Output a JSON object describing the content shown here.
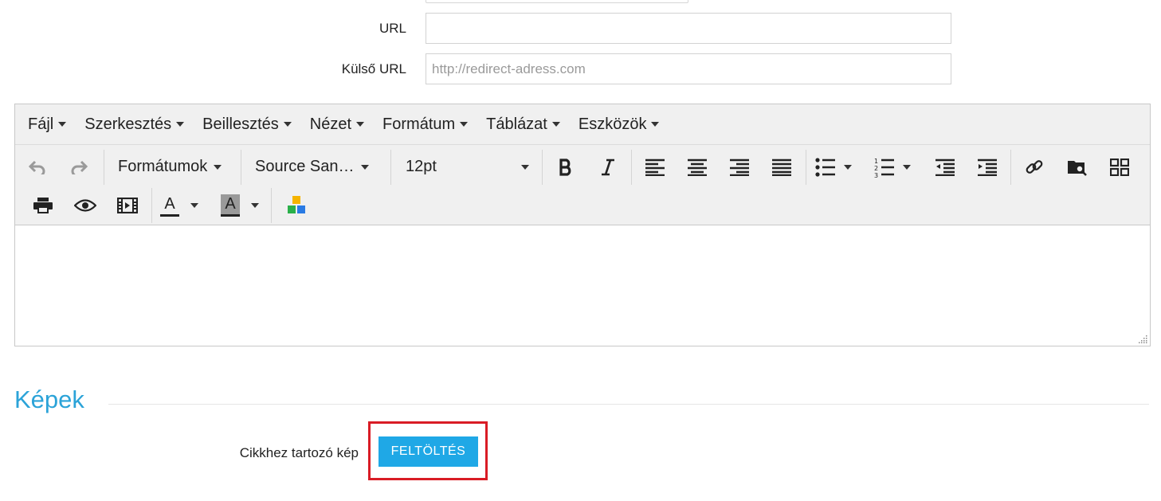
{
  "form": {
    "url_label": "URL",
    "url_value": "",
    "external_url_label": "Külső URL",
    "external_url_placeholder": "http://redirect-adress.com"
  },
  "editor": {
    "menu": [
      {
        "label": "Fájl"
      },
      {
        "label": "Szerkesztés"
      },
      {
        "label": "Beillesztés"
      },
      {
        "label": "Nézet"
      },
      {
        "label": "Formátum"
      },
      {
        "label": "Táblázat"
      },
      {
        "label": "Eszközök"
      }
    ],
    "toolbar": {
      "formats_label": "Formátumok",
      "font_family_label": "Source San…",
      "font_size_label": "12pt",
      "text_color_letter": "A",
      "bg_color_letter": "A",
      "icons": [
        "undo-icon",
        "redo-icon",
        "bold-icon",
        "italic-icon",
        "align-left-icon",
        "align-center-icon",
        "align-right-icon",
        "align-justify-icon",
        "bullet-list-icon",
        "numbered-list-icon",
        "outdent-icon",
        "indent-icon",
        "link-icon",
        "file-browser-icon",
        "template-icon",
        "print-icon",
        "preview-icon",
        "media-icon",
        "text-color-icon",
        "background-color-icon",
        "blocks-icon"
      ]
    },
    "content": ""
  },
  "images_section": {
    "title": "Képek",
    "image_label": "Cikkhez tartozó kép",
    "upload_button": "FELTÖLTÉS"
  },
  "colors": {
    "accent": "#1fa8e6",
    "section_title": "#2ba3d8",
    "highlight": "#d91c25"
  }
}
